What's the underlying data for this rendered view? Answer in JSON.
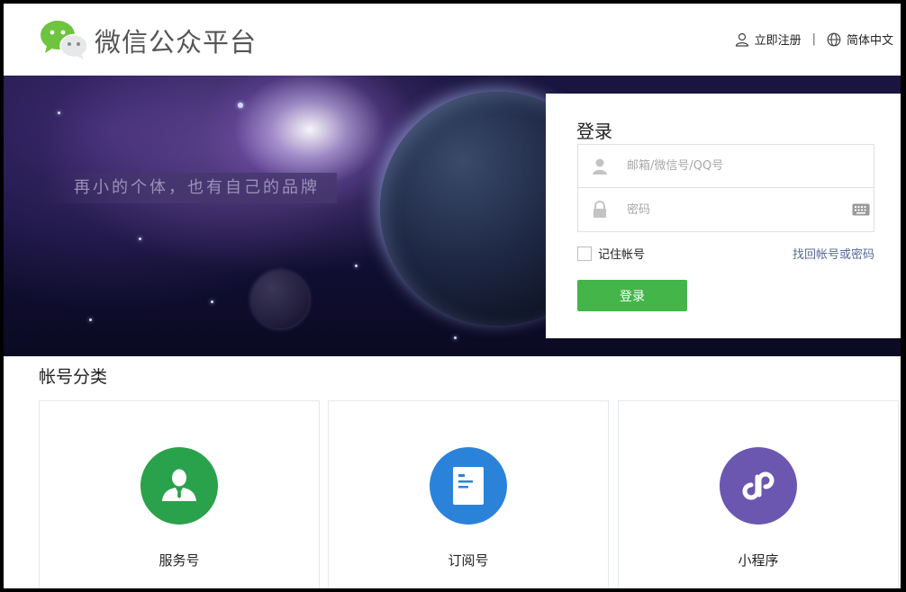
{
  "header": {
    "title": "微信公众平台",
    "register": "立即注册",
    "separator": "|",
    "language": "简体中文"
  },
  "banner": {
    "slogan": "再小的个体，也有自己的品牌"
  },
  "login": {
    "title": "登录",
    "account_placeholder": "邮箱/微信号/QQ号",
    "password_placeholder": "密码",
    "remember": "记住帐号",
    "forgot": "找回帐号或密码",
    "submit": "登录"
  },
  "categories": {
    "title": "帐号分类",
    "items": [
      {
        "label": "服务号",
        "icon": "person-icon",
        "color": "#2aa24b"
      },
      {
        "label": "订阅号",
        "icon": "document-icon",
        "color": "#2b83d9"
      },
      {
        "label": "小程序",
        "icon": "mini-program-icon",
        "color": "#6b56b0"
      }
    ]
  },
  "colors": {
    "accent": "#44b549",
    "link": "#576b95"
  }
}
